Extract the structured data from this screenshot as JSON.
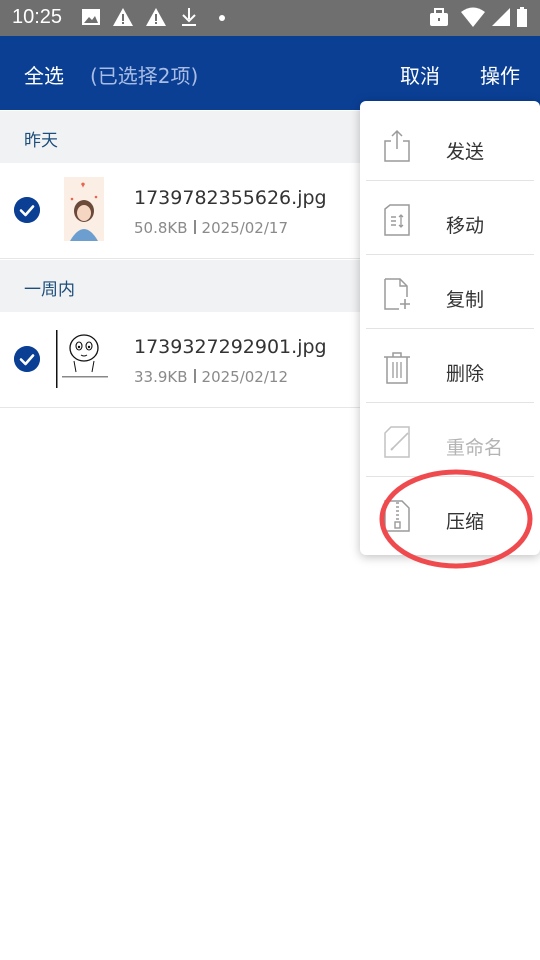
{
  "status_bar": {
    "time": "10:25",
    "icons": [
      "image-icon",
      "warning-icon",
      "warning-icon",
      "download-icon",
      "dot-icon",
      "briefcase-icon",
      "wifi-icon",
      "signal-icon",
      "battery-icon"
    ]
  },
  "app_bar": {
    "select_all": "全选",
    "selected_count": "(已选择2项)",
    "cancel": "取消",
    "operations": "操作",
    "color": "#0a3f94"
  },
  "sections": [
    {
      "header": "昨天",
      "files": [
        {
          "name": "1739782355626.jpg",
          "size": "50.8KB",
          "date": "2025/02/17",
          "checked": true
        }
      ]
    },
    {
      "header": "一周内",
      "files": [
        {
          "name": "1739327292901.jpg",
          "size": "33.9KB",
          "date": "2025/02/12",
          "checked": true
        }
      ]
    }
  ],
  "menu": {
    "items": [
      {
        "label": "发送",
        "icon": "share-icon",
        "enabled": true
      },
      {
        "label": "移动",
        "icon": "move-icon",
        "enabled": true
      },
      {
        "label": "复制",
        "icon": "copy-icon",
        "enabled": true
      },
      {
        "label": "删除",
        "icon": "trash-icon",
        "enabled": true
      },
      {
        "label": "重命名",
        "icon": "rename-icon",
        "enabled": false
      },
      {
        "label": "压缩",
        "icon": "zip-icon",
        "enabled": true
      }
    ],
    "highlight_color": "#ef4a4e"
  }
}
